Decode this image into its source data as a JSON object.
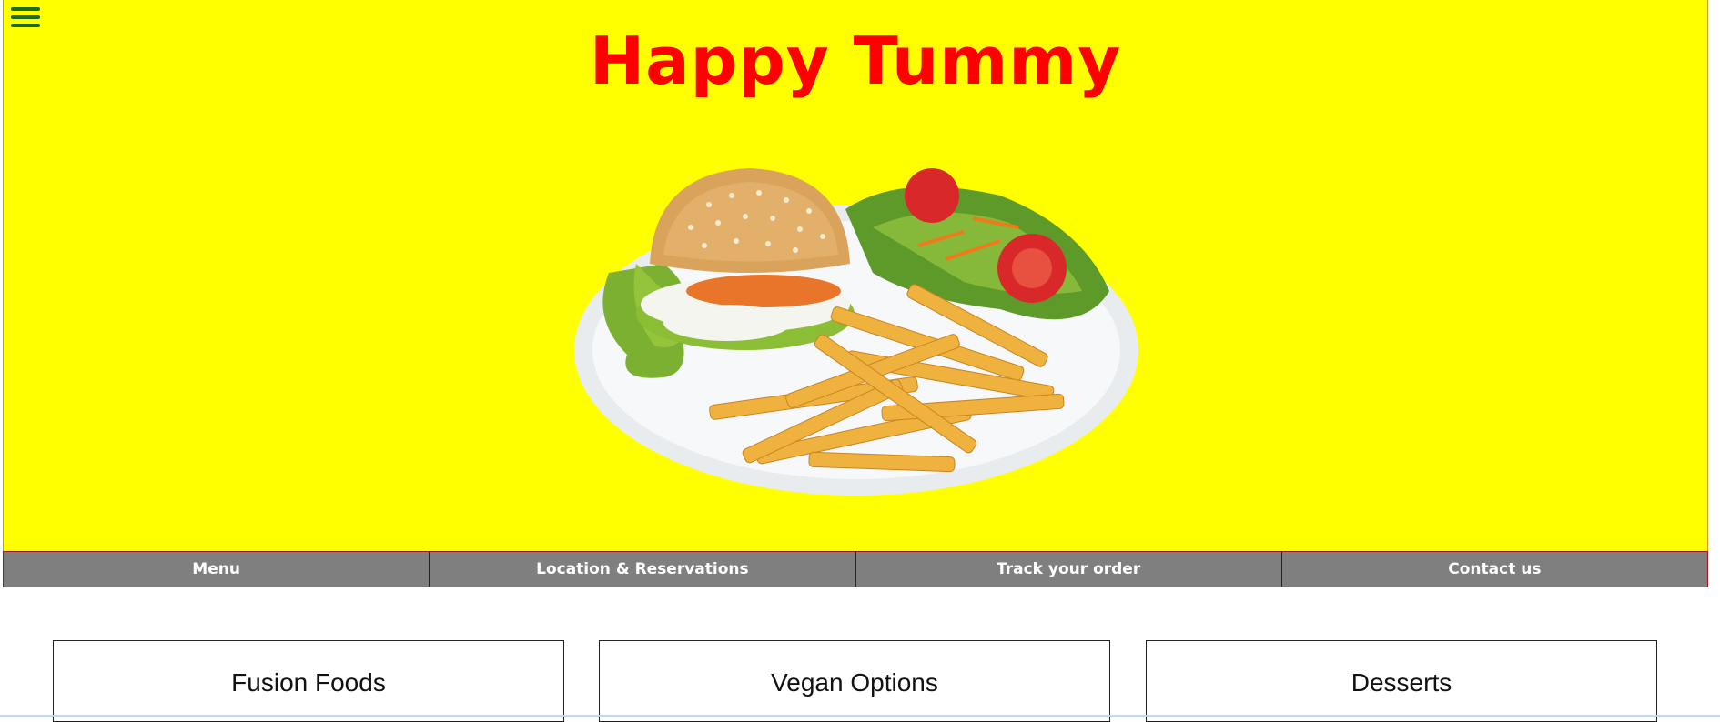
{
  "site": {
    "title": "Happy Tummy",
    "hero_bg": "#ffff00",
    "title_color": "#ff0000"
  },
  "hero": {
    "image_alt": "burger with fries and salad on a plate"
  },
  "nav": {
    "items": [
      {
        "label": "Menu"
      },
      {
        "label": "Location & Reservations"
      },
      {
        "label": "Track your order"
      },
      {
        "label": "Contact us"
      }
    ]
  },
  "cards": [
    {
      "title": "Fusion Foods"
    },
    {
      "title": "Vegan Options"
    },
    {
      "title": "Desserts"
    }
  ],
  "icons": {
    "menu_toggle": "hamburger-menu-icon"
  }
}
